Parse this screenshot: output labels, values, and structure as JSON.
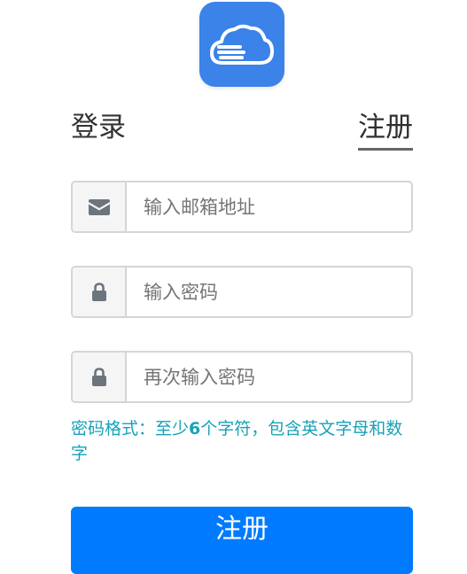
{
  "logo": {
    "icon": "cloud-icon",
    "background": "#3b82e9"
  },
  "tabs": {
    "login_label": "登录",
    "register_label": "注册",
    "active": "register"
  },
  "form": {
    "email": {
      "icon": "envelope-icon",
      "placeholder": "输入邮箱地址",
      "value": ""
    },
    "password": {
      "icon": "lock-icon",
      "placeholder": "输入密码",
      "value": ""
    },
    "confirm_password": {
      "icon": "lock-icon",
      "placeholder": "再次输入密码",
      "value": ""
    },
    "hint": {
      "prefix": "密码格式：至少",
      "number": "6",
      "suffix": "个字符，包含英文字母和数字"
    },
    "submit_label": "注册"
  },
  "colors": {
    "primary_button": "#007bff",
    "hint_text": "#17a2b8",
    "input_border": "#d5d5d5",
    "icon": "#6c757d"
  }
}
